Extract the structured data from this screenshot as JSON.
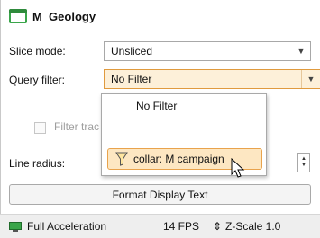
{
  "header": {
    "title": "M_Geology",
    "icon": "green-folder-icon"
  },
  "form": {
    "slice_mode": {
      "label": "Slice mode:",
      "value": "Unsliced"
    },
    "query_filter": {
      "label": "Query filter:",
      "value": "No Filter"
    },
    "filter_tracks": {
      "label": "Filter trac"
    },
    "line_radius": {
      "label": "Line radius:"
    }
  },
  "dropdown": {
    "options": [
      "No Filter",
      "collar: M campaign"
    ],
    "selected_index": 1,
    "selected_icon": "funnel-icon"
  },
  "buttons": {
    "format_display_text": "Format Display Text"
  },
  "status": {
    "acceleration": "Full Acceleration",
    "fps": "14 FPS",
    "zscale": "Z-Scale 1.0"
  },
  "colors": {
    "accent_orange": "#e09a3e",
    "selection_fill": "#fde7c2",
    "folder_green": "#3aa54a"
  }
}
